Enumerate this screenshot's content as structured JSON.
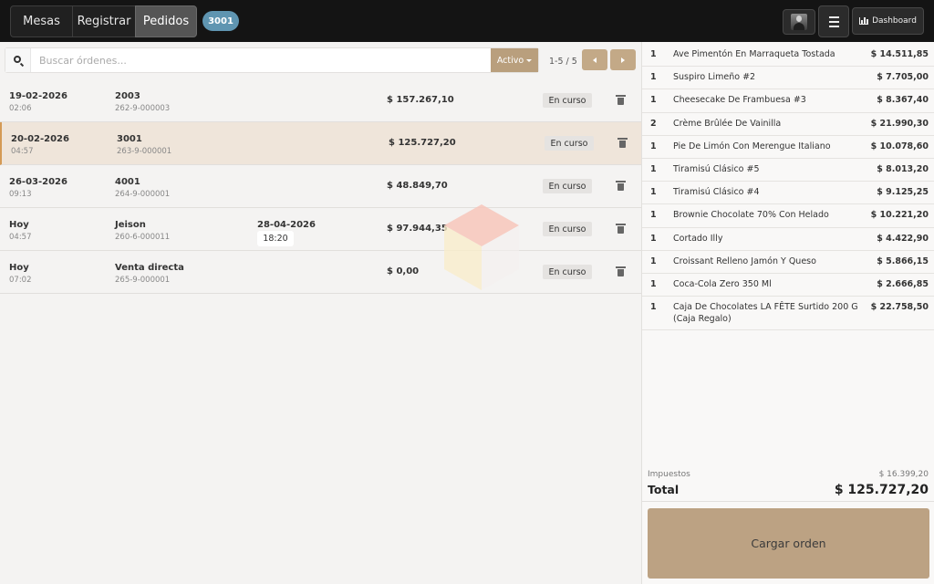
{
  "nav": {
    "tabs": [
      {
        "label": "Mesas"
      },
      {
        "label": "Registrar"
      },
      {
        "label": "Pedidos"
      }
    ],
    "active_order_badge": "3001",
    "dashboard_label": "Dashboard",
    "user_avatar_icon": "user-avatar",
    "menu_icon": "hamburger-icon",
    "dashboard_icon": "bar-chart-icon"
  },
  "search": {
    "placeholder": "Buscar órdenes...",
    "value": "",
    "filter_label": "Activo",
    "pagination": "1-5 / 5"
  },
  "orders": [
    {
      "date": "19-02-2026",
      "time": "02:06",
      "name": "2003",
      "code": "262-9-000003",
      "scheduled_date": "",
      "scheduled_time": "",
      "amount": "$ 157.267,10",
      "status": "En curso"
    },
    {
      "date": "20-02-2026",
      "time": "04:57",
      "name": "3001",
      "code": "263-9-000001",
      "scheduled_date": "",
      "scheduled_time": "",
      "amount": "$ 125.727,20",
      "status": "En curso"
    },
    {
      "date": "26-03-2026",
      "time": "09:13",
      "name": "4001",
      "code": "264-9-000001",
      "scheduled_date": "",
      "scheduled_time": "",
      "amount": "$ 48.849,70",
      "status": "En curso"
    },
    {
      "date": "Hoy",
      "time": "04:57",
      "name": "Jeison",
      "code": "260-6-000011",
      "scheduled_date": "28-04-2026",
      "scheduled_time": "18:20",
      "amount": "$ 97.944,35",
      "status": "En curso"
    },
    {
      "date": "Hoy",
      "time": "07:02",
      "name": "Venta directa",
      "code": "265-9-000001",
      "scheduled_date": "",
      "scheduled_time": "",
      "amount": "$ 0,00",
      "status": "En curso"
    }
  ],
  "order_detail": {
    "items": [
      {
        "qty": "1",
        "name": "Ave Pimentón En Marraqueta Tostada",
        "price": "$ 14.511,85"
      },
      {
        "qty": "1",
        "name": "Suspiro Limeño #2",
        "price": "$ 7.705,00"
      },
      {
        "qty": "1",
        "name": "Cheesecake De Frambuesa #3",
        "price": "$ 8.367,40"
      },
      {
        "qty": "2",
        "name": "Crème Brûlée De Vainilla",
        "price": "$ 21.990,30"
      },
      {
        "qty": "1",
        "name": "Pie De Limón Con Merengue Italiano",
        "price": "$ 10.078,60"
      },
      {
        "qty": "1",
        "name": "Tiramisú Clásico #5",
        "price": "$ 8.013,20"
      },
      {
        "qty": "1",
        "name": "Tiramisú Clásico #4",
        "price": "$ 9.125,25"
      },
      {
        "qty": "1",
        "name": "Brownie Chocolate 70% Con Helado",
        "price": "$ 10.221,20"
      },
      {
        "qty": "1",
        "name": "Cortado Illy",
        "price": "$ 4.422,90"
      },
      {
        "qty": "1",
        "name": "Croissant Relleno Jamón Y Queso",
        "price": "$ 5.866,15"
      },
      {
        "qty": "1",
        "name": "Coca-Cola Zero 350 Ml",
        "price": "$ 2.666,85"
      },
      {
        "qty": "1",
        "name": "Caja De Chocolates LA FÊTE Surtido 200 G (Caja Regalo)",
        "price": "$ 22.758,50"
      }
    ],
    "tax_label": "Impuestos",
    "tax_value": "$ 16.399,20",
    "total_label": "Total",
    "total_value": "$ 125.727,20",
    "load_button": "Cargar orden"
  },
  "colors": {
    "accent": "#b99f7d",
    "badge": "#5f95b1",
    "selected_row": "#efe5da",
    "selected_marker": "#d49a55"
  }
}
